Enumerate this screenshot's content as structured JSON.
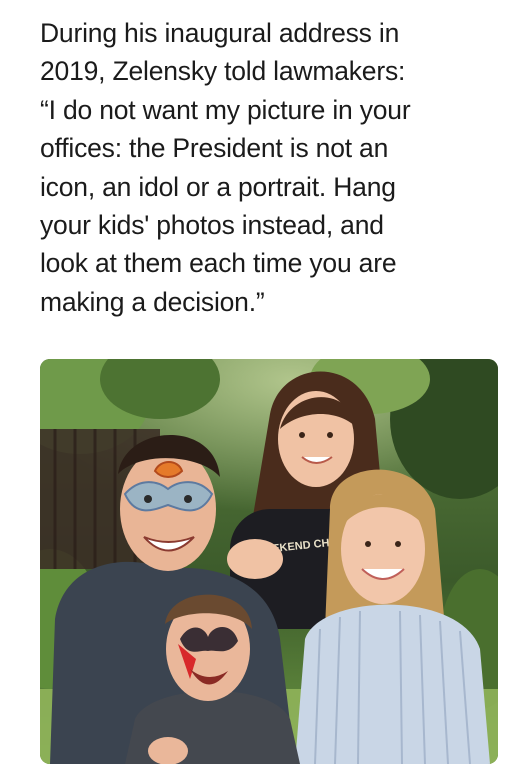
{
  "caption": {
    "lines": [
      "During his inaugural address in",
      "2019, Zelensky told lawmakers:",
      "“I do not want my picture in your",
      "offices: the President is not an",
      "icon, an idol or a portrait. Hang",
      "your kids' photos instead, and",
      "look at them each time you are",
      "making a decision.”"
    ]
  },
  "photo": {
    "shirt_text": "WEEKEND CHEER",
    "colors": {
      "foliage_dark": "#2f4a22",
      "foliage_light": "#6f9a4a",
      "fence": "#3a2a24",
      "grass": "#8fb35a",
      "man_shirt": "#3b4450",
      "girl_shirt": "#1d1d22",
      "woman_dress": "#c9d6e6",
      "skin": "#f0c2a4",
      "hair_blonde": "#c49a5a"
    }
  }
}
